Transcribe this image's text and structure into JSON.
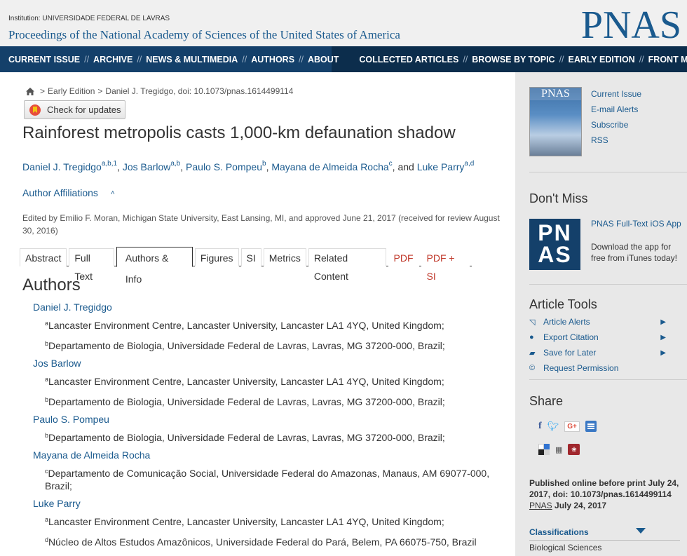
{
  "header": {
    "institution": "Institution: UNIVERSIDADE FEDERAL DE LAVRAS",
    "site_title": "Proceedings of the National Academy of Sciences of the United States of America",
    "logo": "PNAS"
  },
  "nav": {
    "items": [
      "CURRENT ISSUE",
      "ARCHIVE",
      "NEWS & MULTIMEDIA",
      "AUTHORS",
      "ABOUT",
      "COLLECTED ARTICLES",
      "BROWSE BY TOPIC",
      "EARLY EDITION",
      "FRONT MATTER"
    ],
    "separator": "//"
  },
  "breadcrumb": {
    "home_icon": "home-icon",
    "items": [
      "Early Edition",
      "Daniel J. Tregidgo, doi: 10.1073/pnas.1614499114"
    ],
    "sep": ">"
  },
  "check_updates": "Check for updates",
  "article": {
    "title": "Rainforest metropolis casts 1,000-km defaunation shadow",
    "authors": [
      {
        "name": "Daniel J. Tregidgo",
        "sup": "a,b,1",
        "after": ", "
      },
      {
        "name": "Jos Barlow",
        "sup": "a,b",
        "after": ", "
      },
      {
        "name": "Paulo S. Pompeu",
        "sup": "b",
        "after": ", "
      },
      {
        "name": "Mayana de Almeida Rocha",
        "sup": "c",
        "after": ", and "
      },
      {
        "name": "Luke Parry",
        "sup": "a,d",
        "after": ""
      }
    ],
    "affiliations_toggle": "Author Affiliations",
    "edited": "Edited by Emilio F. Moran, Michigan State University, East Lansing, MI, and approved June 21, 2017 (received for review August 30, 2016)"
  },
  "tabs": [
    {
      "label": "Abstract",
      "kind": "normal"
    },
    {
      "label": "Full Text",
      "kind": "normal"
    },
    {
      "label": "Authors & Info",
      "kind": "active"
    },
    {
      "label": "Figures",
      "kind": "normal"
    },
    {
      "label": "SI",
      "kind": "normal"
    },
    {
      "label": "Metrics",
      "kind": "normal"
    },
    {
      "label": "Related Content",
      "kind": "normal"
    },
    {
      "label": "PDF",
      "kind": "pdf"
    },
    {
      "label": "PDF + SI",
      "kind": "pdf"
    }
  ],
  "authors_section": {
    "heading": "Authors",
    "entries": [
      {
        "name": "Daniel J. Tregidgo",
        "affils": [
          {
            "sup": "a",
            "text": "Lancaster Environment Centre, Lancaster University, Lancaster LA1 4YQ, United Kingdom;"
          },
          {
            "sup": "b",
            "text": "Departamento de Biologia, Universidade Federal de Lavras, Lavras, MG 37200-000, Brazil;"
          }
        ]
      },
      {
        "name": "Jos Barlow",
        "affils": [
          {
            "sup": "a",
            "text": "Lancaster Environment Centre, Lancaster University, Lancaster LA1 4YQ, United Kingdom;"
          },
          {
            "sup": "b",
            "text": "Departamento de Biologia, Universidade Federal de Lavras, Lavras, MG 37200-000, Brazil;"
          }
        ]
      },
      {
        "name": "Paulo S. Pompeu",
        "affils": [
          {
            "sup": "b",
            "text": "Departamento de Biologia, Universidade Federal de Lavras, Lavras, MG 37200-000, Brazil;"
          }
        ]
      },
      {
        "name": "Mayana de Almeida Rocha",
        "affils": [
          {
            "sup": "c",
            "text": "Departamento de Comunicação Social, Universidade Federal do Amazonas, Manaus, AM 69077-000, Brazil;"
          }
        ]
      },
      {
        "name": "Luke Parry",
        "affils": [
          {
            "sup": "a",
            "text": "Lancaster Environment Centre, Lancaster University, Lancaster LA1 4YQ, United Kingdom;"
          },
          {
            "sup": "d",
            "text": "Núcleo de Altos Estudos Amazônicos, Universidade Federal do Pará, Belem, PA 66075-750, Brazil"
          }
        ]
      }
    ]
  },
  "sidebar": {
    "cover_title": "PNAS",
    "links": [
      "Current Issue",
      "E-mail Alerts",
      "Subscribe",
      "RSS"
    ],
    "dont_miss": "Don't Miss",
    "app_logo": "PN AS",
    "app_title": "PNAS Full-Text iOS App",
    "app_desc": "Download the app for free from iTunes today!",
    "tools_heading": "Article Tools",
    "tools": [
      {
        "icon": "rss-icon",
        "label": "Article Alerts"
      },
      {
        "icon": "globe-icon",
        "label": "Export Citation"
      },
      {
        "icon": "folder-icon",
        "label": "Save for Later"
      },
      {
        "icon": "copyright-icon",
        "label": "Request Permission"
      }
    ],
    "share_heading": "Share",
    "share_icons": [
      "facebook-icon",
      "twitter-icon",
      "google-plus-icon",
      "list-icon",
      "delicious-icon",
      "digg-icon",
      "mendeley-icon"
    ],
    "pub_line1": "Published online before print July 24, 2017, doi: 10.1073/pnas.1614499114",
    "pub_journal": "PNAS",
    "pub_date": "July 24, 2017",
    "classifications": "Classifications",
    "class_value": "Biological Sciences"
  },
  "colors": {
    "nav": "#14406a",
    "nav_dark": "#0c2d4c",
    "link": "#1a5a8e",
    "pdf": "#c0392b",
    "sidebar_bg": "#e8e8e8"
  }
}
